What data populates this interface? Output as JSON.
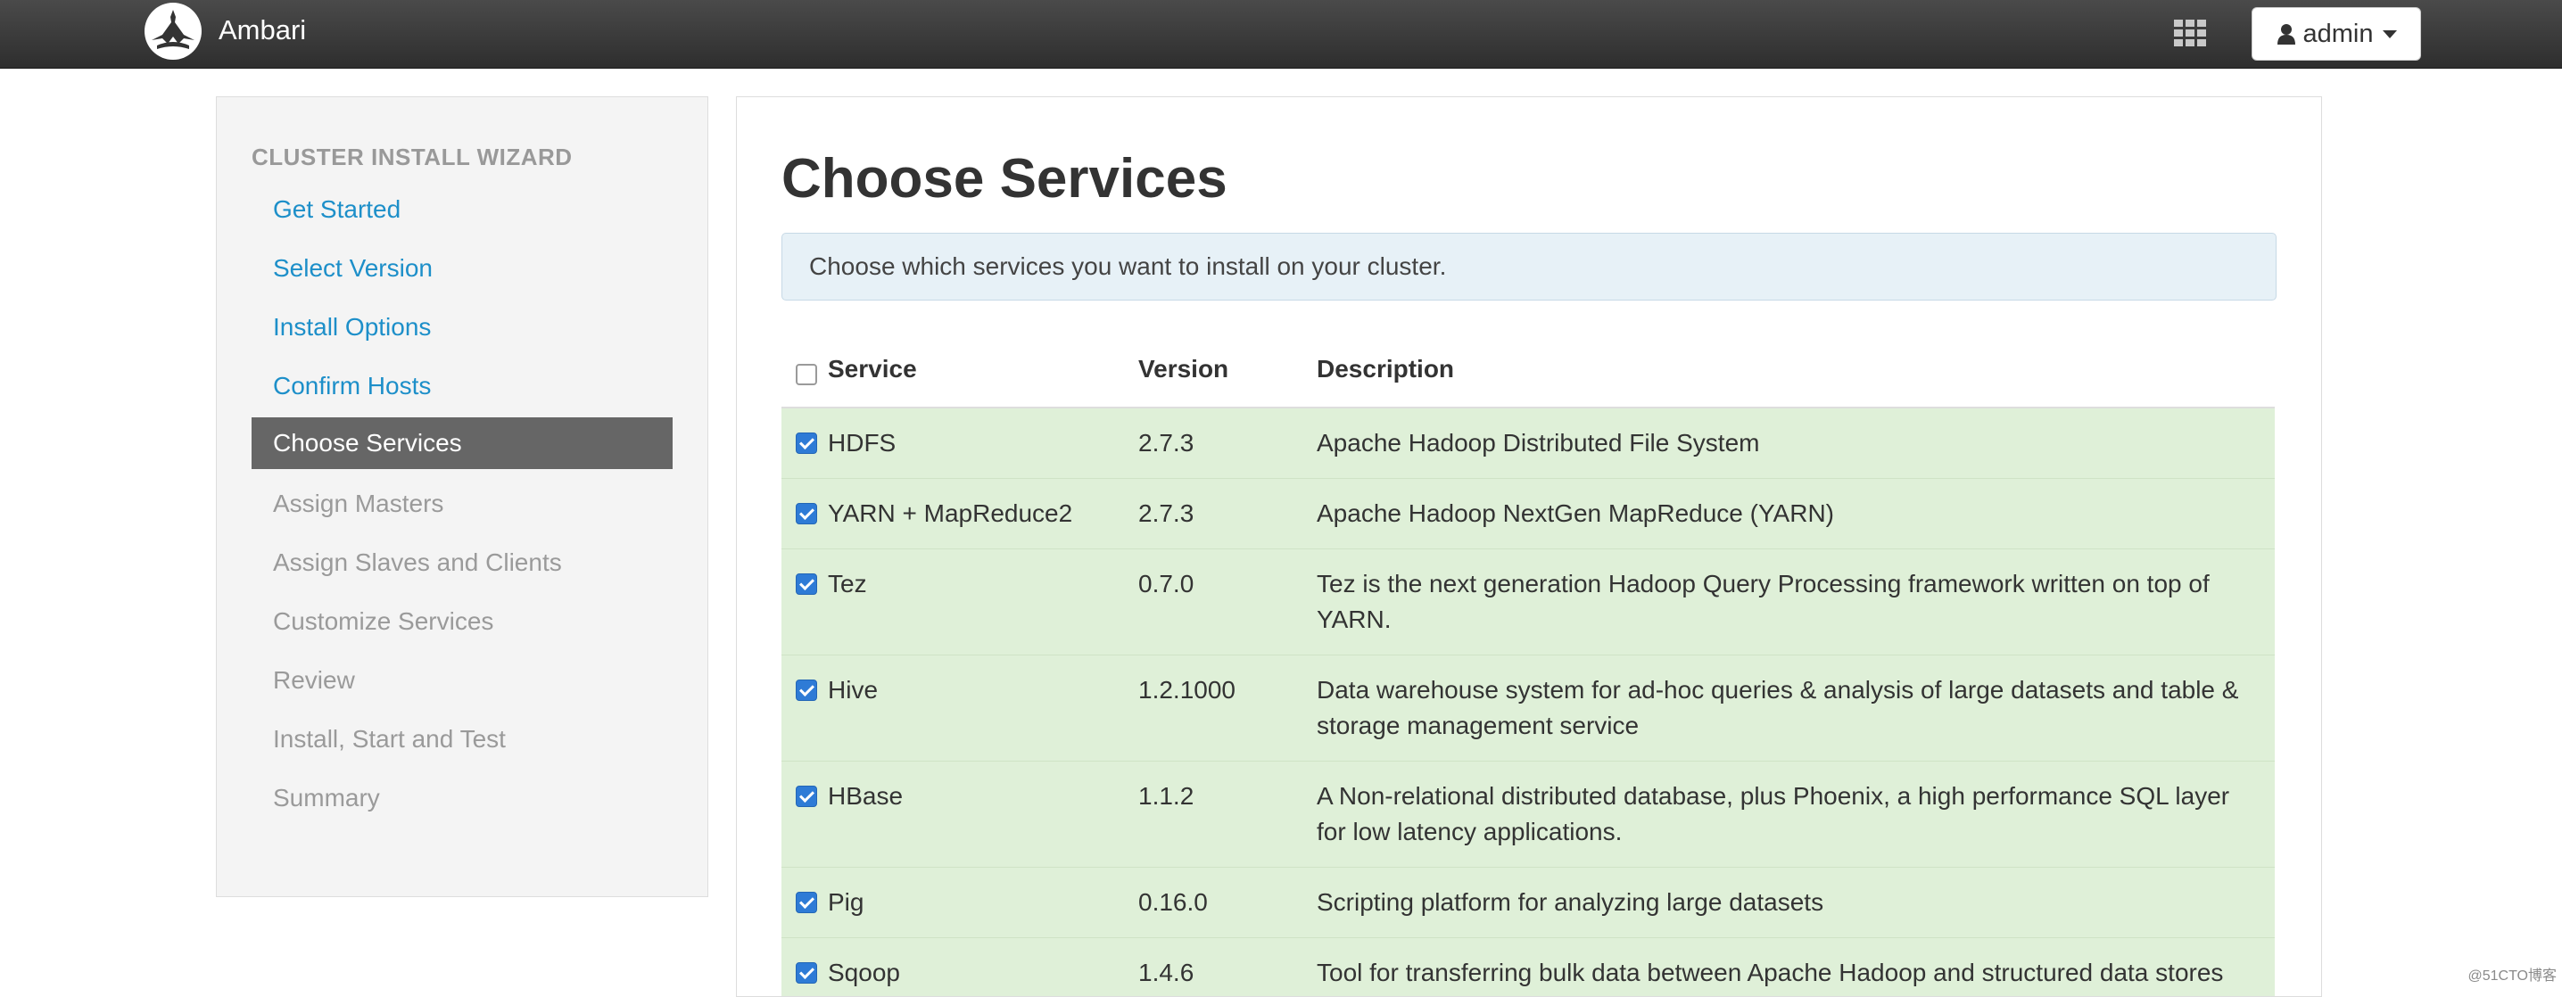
{
  "app": {
    "name": "Ambari",
    "user_label": "admin"
  },
  "sidebar": {
    "title": "CLUSTER INSTALL WIZARD",
    "items": [
      {
        "label": "Get Started",
        "state": "done"
      },
      {
        "label": "Select Version",
        "state": "done"
      },
      {
        "label": "Install Options",
        "state": "done"
      },
      {
        "label": "Confirm Hosts",
        "state": "done"
      },
      {
        "label": "Choose Services",
        "state": "active"
      },
      {
        "label": "Assign Masters",
        "state": "pending"
      },
      {
        "label": "Assign Slaves and Clients",
        "state": "pending"
      },
      {
        "label": "Customize Services",
        "state": "pending"
      },
      {
        "label": "Review",
        "state": "pending"
      },
      {
        "label": "Install, Start and Test",
        "state": "pending"
      },
      {
        "label": "Summary",
        "state": "pending"
      }
    ]
  },
  "main": {
    "title": "Choose Services",
    "info": "Choose which services you want to install on your cluster.",
    "table": {
      "headers": {
        "service": "Service",
        "version": "Version",
        "description": "Description"
      },
      "select_all_checked": false,
      "rows": [
        {
          "service": "HDFS",
          "version": "2.7.3",
          "description": "Apache Hadoop Distributed File System",
          "checked": true
        },
        {
          "service": "YARN + MapReduce2",
          "version": "2.7.3",
          "description": "Apache Hadoop NextGen MapReduce (YARN)",
          "checked": true
        },
        {
          "service": "Tez",
          "version": "0.7.0",
          "description": "Tez is the next generation Hadoop Query Processing framework written on top of YARN.",
          "checked": true
        },
        {
          "service": "Hive",
          "version": "1.2.1000",
          "description": "Data warehouse system for ad-hoc queries & analysis of large datasets and table & storage management service",
          "checked": true
        },
        {
          "service": "HBase",
          "version": "1.1.2",
          "description": "A Non-relational distributed database, plus Phoenix, a high performance SQL layer for low latency applications.",
          "checked": true
        },
        {
          "service": "Pig",
          "version": "0.16.0",
          "description": "Scripting platform for analyzing large datasets",
          "checked": true
        },
        {
          "service": "Sqoop",
          "version": "1.4.6",
          "description": "Tool for transferring bulk data between Apache Hadoop and structured data stores",
          "checked": true
        }
      ]
    }
  },
  "icons": {
    "logo": "ambari-logo-icon",
    "apps": "grid-apps-icon",
    "user": "user-icon",
    "dropdown": "caret-down-icon"
  },
  "watermark": "@51CTO博客"
}
